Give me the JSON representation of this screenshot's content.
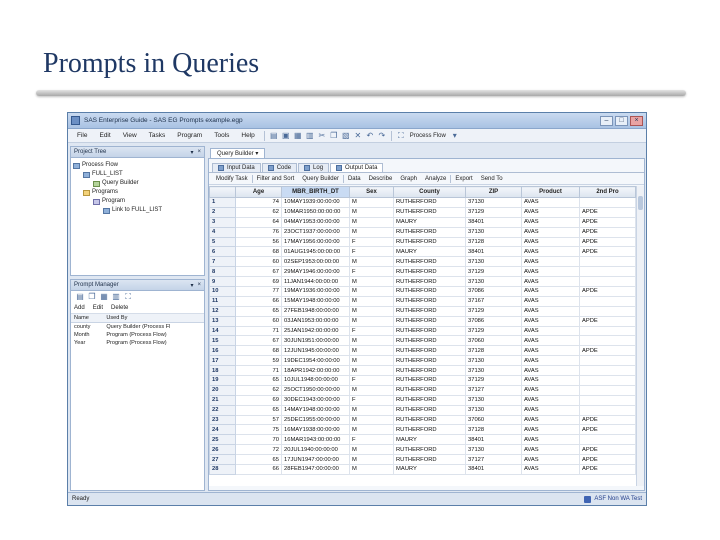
{
  "slide": {
    "title": "Prompts in Queries"
  },
  "window": {
    "title": "SAS Enterprise Guide - SAS EG Prompts example.egp"
  },
  "menu": [
    "File",
    "Edit",
    "View",
    "Tasks",
    "Program",
    "Tools",
    "Help"
  ],
  "toolbar": {
    "process_flow_label": "Process Flow"
  },
  "project_tree": {
    "title": "Project Tree",
    "items": [
      "Process Flow",
      "FULL_LIST",
      "Query Builder",
      "Programs",
      "Program",
      "Link to FULL_LIST"
    ]
  },
  "prompt_manager": {
    "title": "Prompt Manager",
    "actions": {
      "add": "Add",
      "edit": "Edit",
      "delete": "Delete"
    },
    "headers": {
      "name": "Name",
      "used_by": "Used By"
    },
    "rows": [
      {
        "name": "county",
        "used_by": "Query Builder (Process Fl"
      },
      {
        "name": "Month",
        "used_by": "Program (Process Flow)"
      },
      {
        "name": "Year",
        "used_by": "Program (Process Flow)"
      }
    ]
  },
  "doc_tab": {
    "label": "Query Builder"
  },
  "view_tabs": [
    "Input Data",
    "Code",
    "Log",
    "Output Data"
  ],
  "data_toolbar": [
    "Modify Task",
    "Filter and Sort",
    "Query Builder",
    "Data",
    "Describe",
    "Graph",
    "Analyze",
    "Export",
    "Send To"
  ],
  "grid": {
    "columns": [
      "",
      "Age",
      "MBR_BIRTH_DT",
      "Sex",
      "County",
      "ZIP",
      "Product",
      "2nd Pro"
    ],
    "rows": [
      [
        "1",
        "74",
        "10MAY1939:00:00:00",
        "M",
        "RUTHERFORD",
        "37130",
        "AVAS",
        ""
      ],
      [
        "2",
        "62",
        "10MAR1950:00:00:00",
        "M",
        "RUTHERFORD",
        "37129",
        "AVAS",
        "APDE"
      ],
      [
        "3",
        "64",
        "04MAY1953:00:00:00",
        "M",
        "MAURY",
        "38401",
        "AVAS",
        "APDE"
      ],
      [
        "4",
        "76",
        "23OCT1937:00:00:00",
        "M",
        "RUTHERFORD",
        "37130",
        "AVAS",
        "APDE"
      ],
      [
        "5",
        "56",
        "17MAY1956:00:00:00",
        "F",
        "RUTHERFORD",
        "37128",
        "AVAS",
        "APDE"
      ],
      [
        "6",
        "68",
        "01AUG1945:00:00:00",
        "F",
        "MAURY",
        "38401",
        "AVAS",
        "APDE"
      ],
      [
        "7",
        "60",
        "02SEP1953:00:00:00",
        "M",
        "RUTHERFORD",
        "37130",
        "AVAS",
        ""
      ],
      [
        "8",
        "67",
        "29MAY1946:00:00:00",
        "F",
        "RUTHERFORD",
        "37129",
        "AVAS",
        ""
      ],
      [
        "9",
        "69",
        "11JAN1944:00:00:00",
        "M",
        "RUTHERFORD",
        "37130",
        "AVAS",
        ""
      ],
      [
        "10",
        "77",
        "19MAY1936:00:00:00",
        "M",
        "RUTHERFORD",
        "37086",
        "AVAS",
        "APDE"
      ],
      [
        "11",
        "66",
        "15MAY1948:00:00:00",
        "M",
        "RUTHERFORD",
        "37167",
        "AVAS",
        ""
      ],
      [
        "12",
        "65",
        "27FEB1948:00:00:00",
        "M",
        "RUTHERFORD",
        "37129",
        "AVAS",
        ""
      ],
      [
        "13",
        "60",
        "03JAN1953:00:00:00",
        "M",
        "RUTHERFORD",
        "37086",
        "AVAS",
        "APDE"
      ],
      [
        "14",
        "71",
        "25JAN1942:00:00:00",
        "F",
        "RUTHERFORD",
        "37129",
        "AVAS",
        ""
      ],
      [
        "15",
        "67",
        "30JUN1951:00:00:00",
        "M",
        "RUTHERFORD",
        "37060",
        "AVAS",
        ""
      ],
      [
        "16",
        "68",
        "12JUN1945:00:00:00",
        "M",
        "RUTHERFORD",
        "37128",
        "AVAS",
        "APDE"
      ],
      [
        "17",
        "59",
        "19DEC1954:00:00:00",
        "M",
        "RUTHERFORD",
        "37130",
        "AVAS",
        ""
      ],
      [
        "18",
        "71",
        "18APR1942:00:00:00",
        "M",
        "RUTHERFORD",
        "37130",
        "AVAS",
        ""
      ],
      [
        "19",
        "65",
        "10JUL1948:00:00:00",
        "F",
        "RUTHERFORD",
        "37129",
        "AVAS",
        ""
      ],
      [
        "20",
        "62",
        "25OCT1950:00:00:00",
        "M",
        "RUTHERFORD",
        "37127",
        "AVAS",
        ""
      ],
      [
        "21",
        "69",
        "30DEC1943:00:00:00",
        "F",
        "RUTHERFORD",
        "37130",
        "AVAS",
        ""
      ],
      [
        "22",
        "65",
        "14MAY1948:00:00:00",
        "M",
        "RUTHERFORD",
        "37130",
        "AVAS",
        ""
      ],
      [
        "23",
        "57",
        "25DEC1955:00:00:00",
        "M",
        "RUTHERFORD",
        "37060",
        "AVAS",
        "APDE"
      ],
      [
        "24",
        "75",
        "16MAY1938:00:00:00",
        "M",
        "RUTHERFORD",
        "37128",
        "AVAS",
        "APDE"
      ],
      [
        "25",
        "70",
        "16MAR1943:00:00:00",
        "F",
        "MAURY",
        "38401",
        "AVAS",
        ""
      ],
      [
        "26",
        "72",
        "20JUL1940:00:00:00",
        "M",
        "RUTHERFORD",
        "37130",
        "AVAS",
        "APDE"
      ],
      [
        "27",
        "65",
        "17JUN1947:00:00:00",
        "M",
        "RUTHERFORD",
        "37127",
        "AVAS",
        "APDE"
      ],
      [
        "28",
        "66",
        "28FEB1947:00:00:00",
        "M",
        "MAURY",
        "38401",
        "AVAS",
        "APDE"
      ]
    ]
  },
  "status": {
    "left": "Ready",
    "right": "ASF Non WA Test"
  },
  "colors": {
    "title_text": "#1f3864",
    "window_frame": "#5b7fa9",
    "selected_header": "#c9dbf3"
  }
}
